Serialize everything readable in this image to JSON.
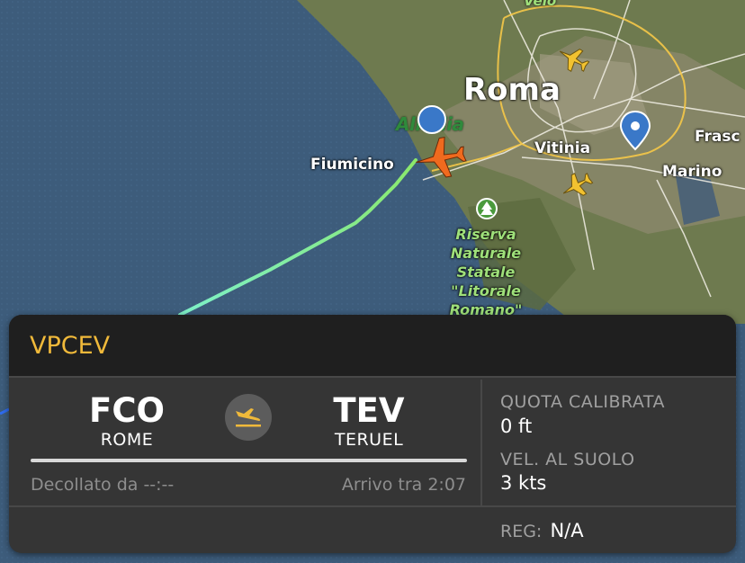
{
  "map": {
    "city_label": "Roma",
    "towns": [
      "Fiumicino",
      "Vitinia",
      "Marino",
      "Frasc"
    ],
    "park_label_lines": [
      "Riserva",
      "Naturale",
      "Statale",
      "\"Litorale",
      "Romano\""
    ],
    "partial_label": "Velo",
    "airline_logo_text": "Alitalia",
    "icons": [
      "flight-track",
      "selected-plane-icon",
      "traffic-plane-icon",
      "location-pin-icon",
      "park-tree-icon"
    ]
  },
  "flight": {
    "callsign": "VPCEV",
    "origin": {
      "code": "FCO",
      "city": "ROME"
    },
    "destination": {
      "code": "TEV",
      "city": "TERUEL"
    },
    "departed_label": "Decollato da --:--",
    "arrival_label": "Arrivo tra 2:07",
    "progress": 1.0
  },
  "stats": {
    "altitude_label": "QUOTA CALIBRATA",
    "altitude_value": "0 ft",
    "speed_label": "VEL. AL SUOLO",
    "speed_value": "3 kts",
    "reg_label": "REG:",
    "reg_value": "N/A"
  },
  "colors": {
    "callsign": "#f0b93a",
    "selected_plane": "#f06a1e",
    "traffic_plane": "#f2c230",
    "track_start": "#7ef0c8",
    "track_end": "#8be86a",
    "pin": "#3a78c8"
  }
}
